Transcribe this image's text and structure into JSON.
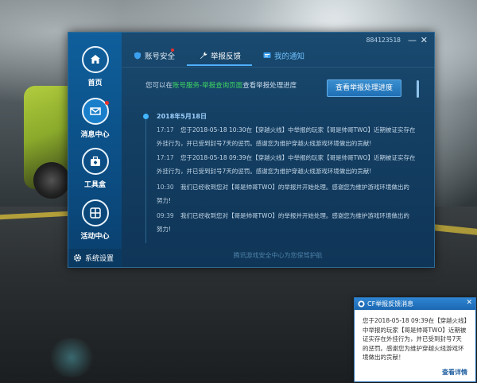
{
  "window": {
    "account_id": "884123518",
    "minimize": "—",
    "close": "✕"
  },
  "sidebar": {
    "items": [
      {
        "label": "首页",
        "icon": "home-icon"
      },
      {
        "label": "消息中心",
        "icon": "mail-icon"
      },
      {
        "label": "工具盒",
        "icon": "toolbox-icon"
      },
      {
        "label": "活动中心",
        "icon": "activity-icon"
      }
    ],
    "settings_label": "系统设置"
  },
  "tabs": [
    {
      "label": "账号安全",
      "icon": "shield-icon"
    },
    {
      "label": "举报反馈",
      "icon": "wrench-icon"
    },
    {
      "label": "我的通知",
      "icon": "message-icon"
    }
  ],
  "hint": {
    "prefix": "您可以在",
    "link": "账号服务-举报查询页面",
    "suffix": "查看举报处理进度"
  },
  "check_button": "查看举报处理进度",
  "timeline": {
    "date": "2018年5月18日",
    "entries": [
      {
        "time": "17:17",
        "line1": "您于2018-05-18 10:30在【穿越火线】中举报的玩家【哥是帅哥TWO】近期被证实存在",
        "line2": "外挂行为，并已受到封号7天的惩罚。感谢您为维护穿越火线游戏环境做出的贡献!"
      },
      {
        "time": "17:17",
        "line1": "您于2018-05-18 09:39在【穿越火线】中举报的玩家【哥是帅哥TWO】近期被证实存在",
        "line2": "外挂行为，并已受到封号7天的惩罚。感谢您为维护穿越火线游戏环境做出的贡献!"
      },
      {
        "time": "10:30",
        "line1": "我们已经收到您对【哥是帅哥TWO】的举报并开始处理。感谢您为维护游戏环境做出的",
        "line2": "努力!"
      },
      {
        "time": "09:39",
        "line1": "我们已经收到您对【哥是帅哥TWO】的举报并开始处理。感谢您为维护游戏环境做出的",
        "line2": "努力!"
      }
    ]
  },
  "footer": "腾讯游戏安全中心为您保驾护航",
  "popup": {
    "title": "CF举报反馈消息",
    "body_1": "您于2018-05-18 09:39在【穿越火线】",
    "body_2": "中举报的玩家【哥是帅哥TWO】近期被",
    "body_3": "证实存在外挂行为，并已受到封号7天",
    "body_4": "的惩罚。感谢您为维护穿越火线游戏环",
    "body_5": "境做出的贡献！",
    "link": "查看详情",
    "close": "✕"
  }
}
